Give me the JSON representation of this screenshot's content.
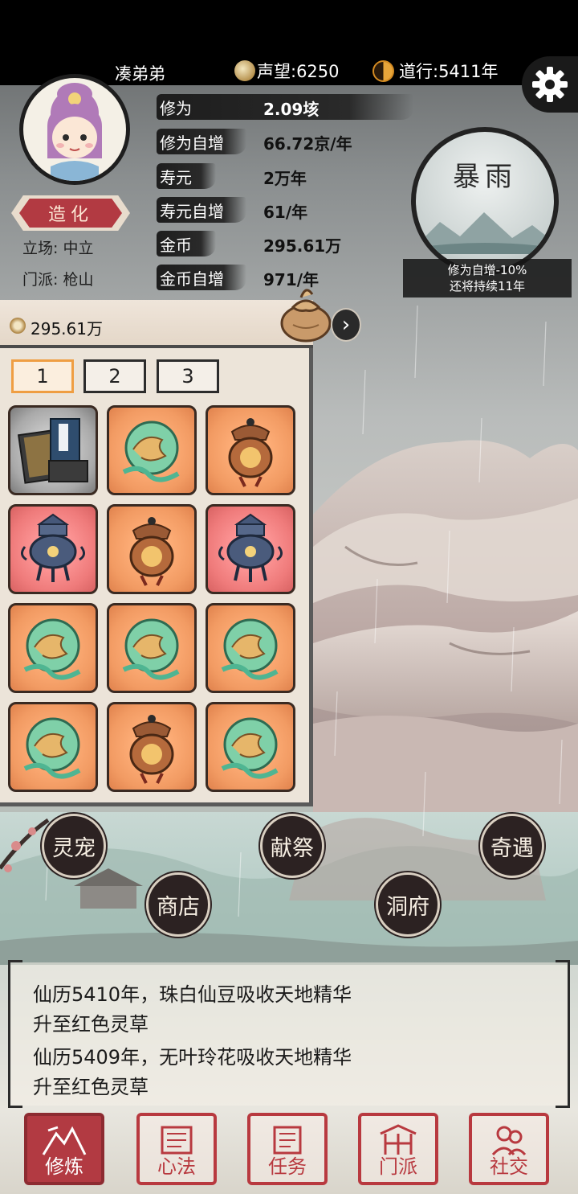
{
  "header": {
    "player_name": "凑弟弟",
    "reputation": "声望:6250",
    "dao_years": "道行:5411年"
  },
  "profile": {
    "rank_button": "造化",
    "stance": "立场: 中立",
    "sect": "门派: 枪山"
  },
  "stats": [
    {
      "label": "修为",
      "value": "2.09垓"
    },
    {
      "label": "修为自增",
      "value": "66.72京/年"
    },
    {
      "label": "寿元",
      "value": "2万年"
    },
    {
      "label": "寿元自增",
      "value": "61/年"
    },
    {
      "label": "金币",
      "value": "295.61万"
    },
    {
      "label": "金币自增",
      "value": "971/年"
    }
  ],
  "weather": {
    "title": "暴雨",
    "effect": "修为自增-10%",
    "duration": "还将持续11年"
  },
  "inventory": {
    "money": "295.61万",
    "pages": [
      "1",
      "2",
      "3"
    ],
    "active_page": "1",
    "items": [
      {
        "type": "book",
        "rarity": "gray"
      },
      {
        "type": "jade-orb",
        "rarity": "orange"
      },
      {
        "type": "bronze-lantern",
        "rarity": "orange"
      },
      {
        "type": "blue-censer",
        "rarity": "red"
      },
      {
        "type": "bronze-lantern",
        "rarity": "orange"
      },
      {
        "type": "blue-censer",
        "rarity": "red"
      },
      {
        "type": "jade-orb",
        "rarity": "orange"
      },
      {
        "type": "jade-orb",
        "rarity": "orange"
      },
      {
        "type": "jade-orb",
        "rarity": "orange"
      },
      {
        "type": "jade-orb",
        "rarity": "orange"
      },
      {
        "type": "bronze-lantern",
        "rarity": "orange"
      },
      {
        "type": "jade-orb",
        "rarity": "orange"
      }
    ]
  },
  "map_buttons": {
    "pet": "灵宠",
    "offering": "献祭",
    "encounter": "奇遇",
    "shop": "商店",
    "cave": "洞府"
  },
  "log": [
    "仙历5410年，珠白仙豆吸收天地精华",
    "升至红色灵草",
    "仙历5409年，无叶玲花吸收天地精华",
    "升至红色灵草"
  ],
  "nav": [
    {
      "label": "修炼",
      "active": true
    },
    {
      "label": "心法",
      "active": false
    },
    {
      "label": "任务",
      "active": false
    },
    {
      "label": "门派",
      "active": false
    },
    {
      "label": "社交",
      "active": false
    }
  ],
  "colors": {
    "accent_red": "#b23a42",
    "slot_orange": "#f29b63",
    "slot_red": "#ef7b7b",
    "slot_gray": "#a9a9a9",
    "active_tab": "#ef9e43"
  }
}
